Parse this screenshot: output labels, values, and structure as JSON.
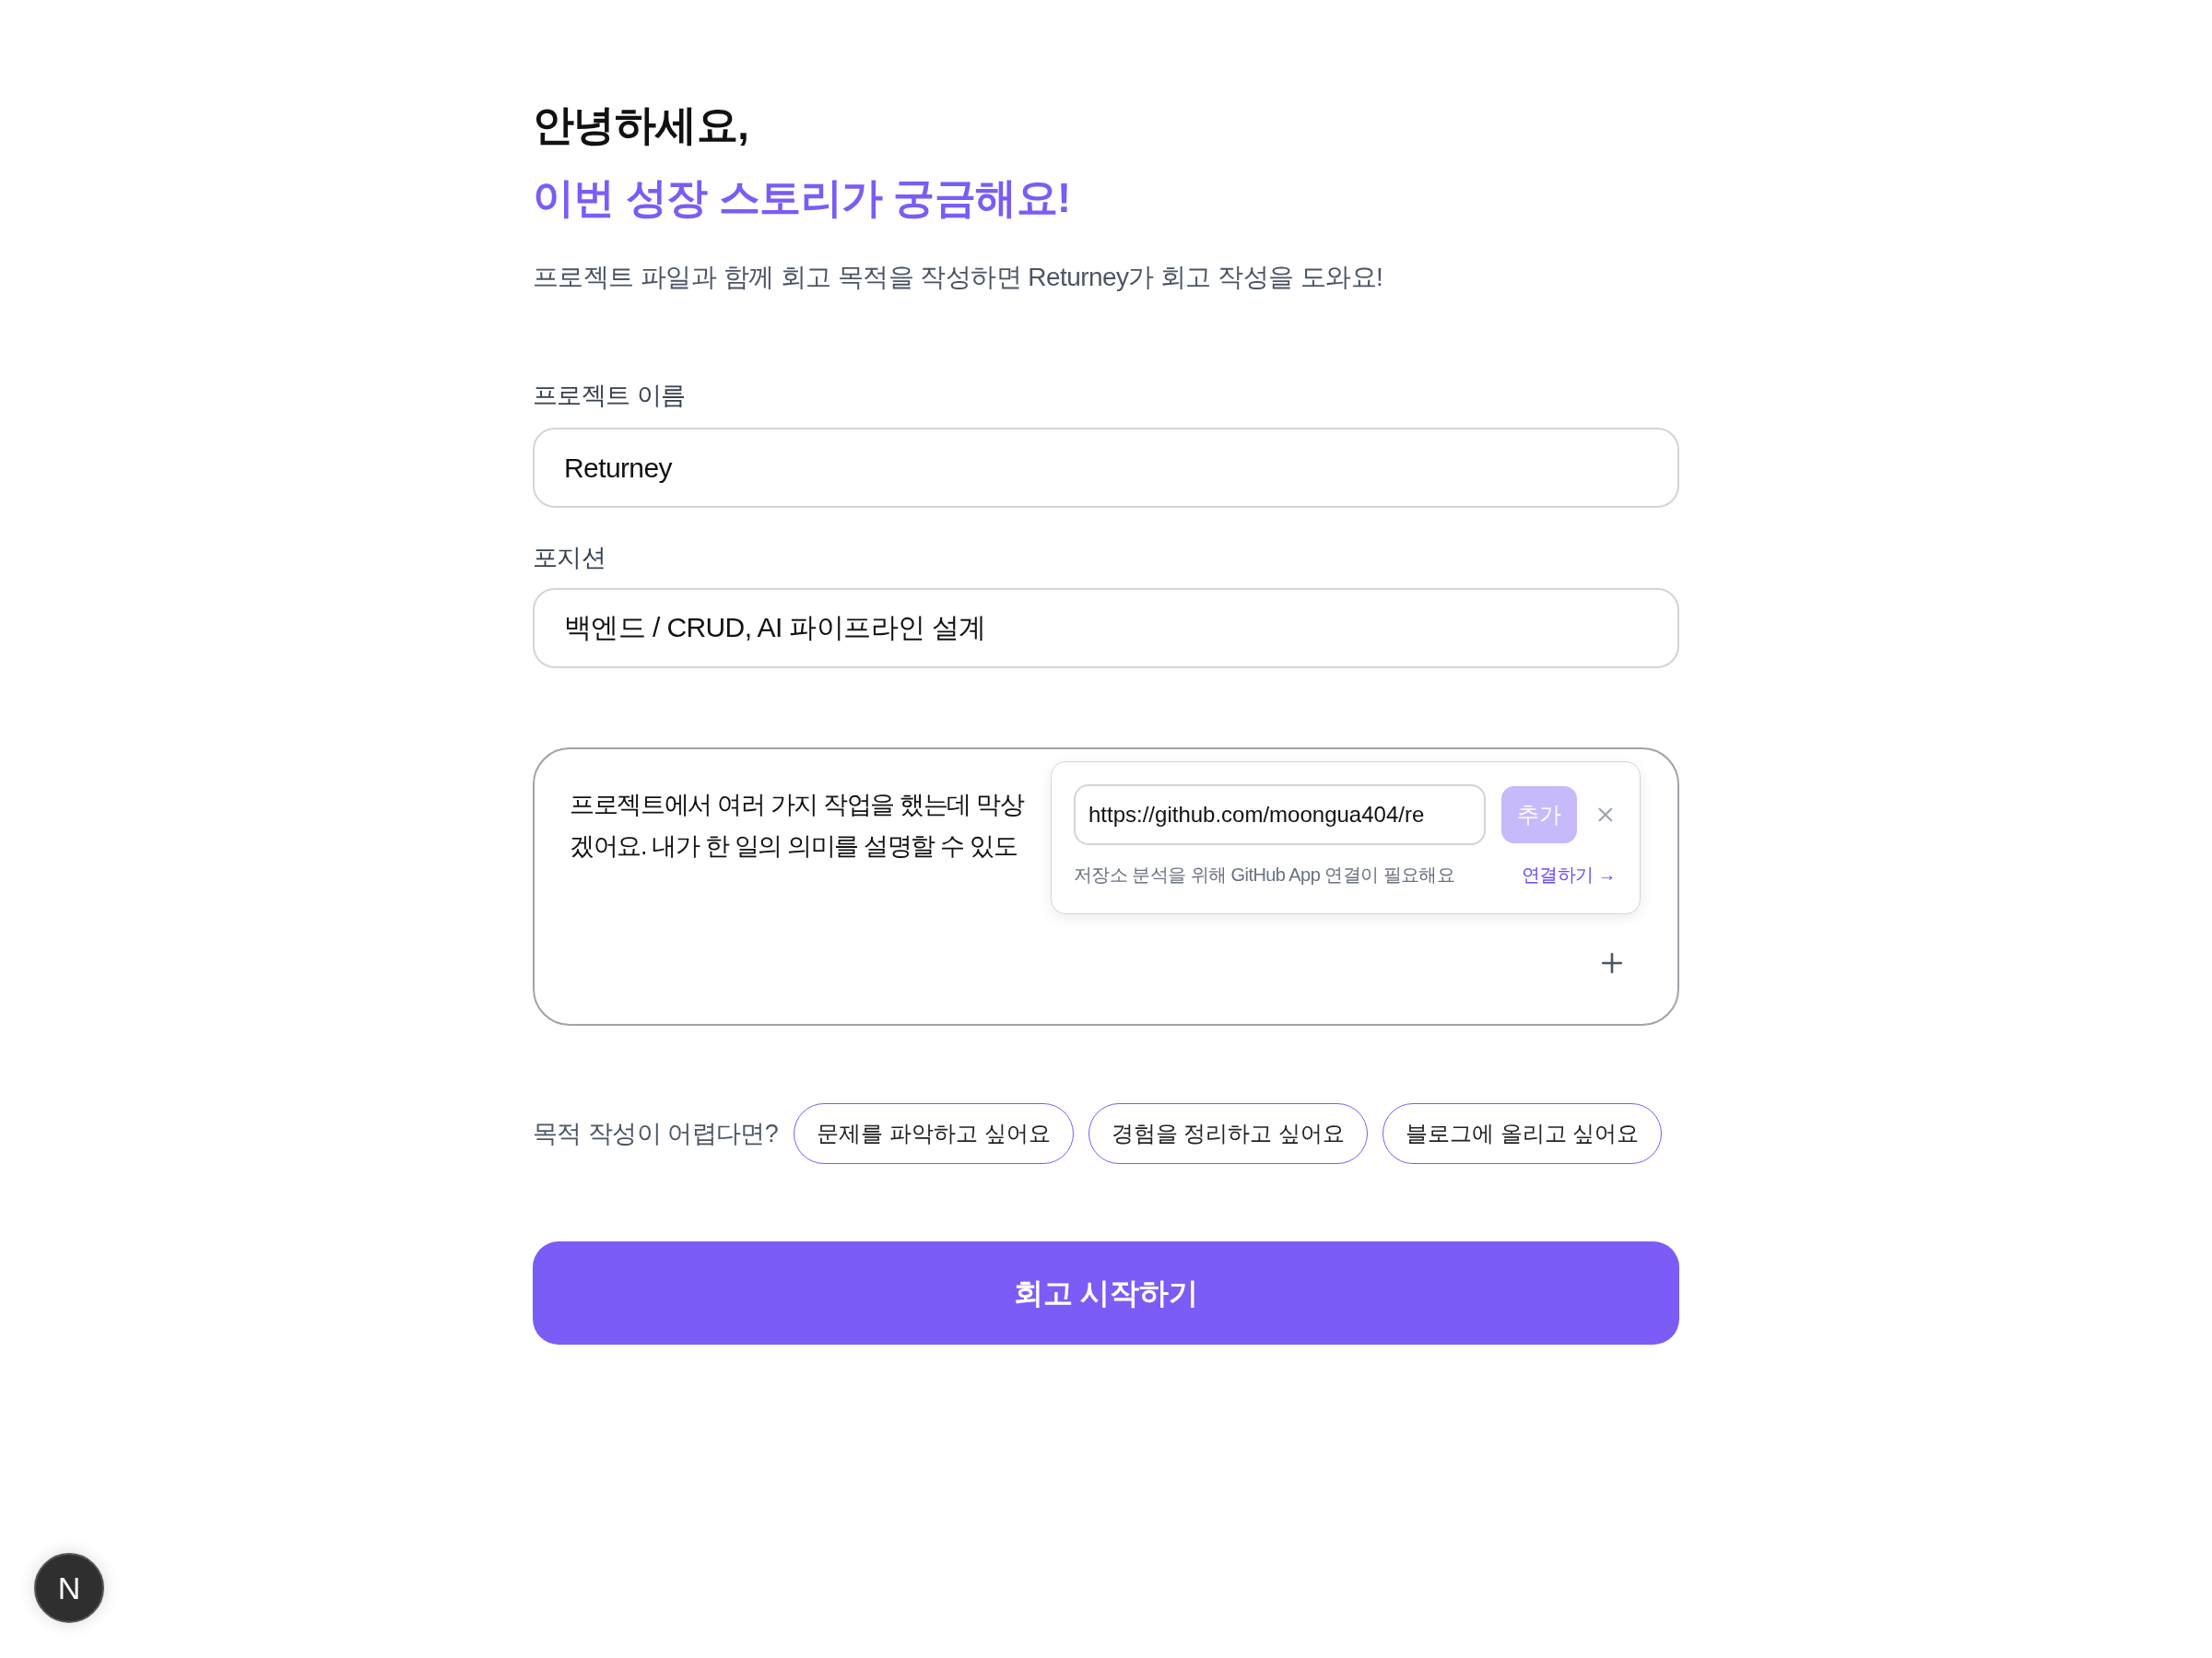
{
  "greeting": {
    "title": "안녕하세요,",
    "subtitle": "이번 성장 스토리가 궁금해요!",
    "description": "프로젝트 파일과 함께 회고 목적을 작성하면 Returney가 회고 작성을 도와요!"
  },
  "fields": [
    {
      "label": "프로젝트 이름",
      "value": "Returney"
    },
    {
      "label": "포지션",
      "value": "백엔드 / CRUD, AI 파이프라인 설계"
    }
  ],
  "purpose": {
    "lines": [
      "프로젝트에서 여러 가지 작업을 했는데 막상",
      "겠어요. 내가 한 일의 의미를 설명할 수 있도"
    ],
    "repo_popover": {
      "url": "https://github.com/moongua404/re",
      "add_button": {
        "label": "추가",
        "disabled": true
      },
      "hint": "저장소 분석을 위해 GitHub App 연결이 필요해요",
      "link": "연결하기 →"
    }
  },
  "suggestions": {
    "label": "목적 작성이 어렵다면?",
    "chips": [
      "문제를 파악하고 싶어요",
      "경험을 정리하고 싶어요",
      "블로그에 올리고 싶어요"
    ]
  },
  "submit_button": "회고 시작하기",
  "dev_badge": "N"
}
